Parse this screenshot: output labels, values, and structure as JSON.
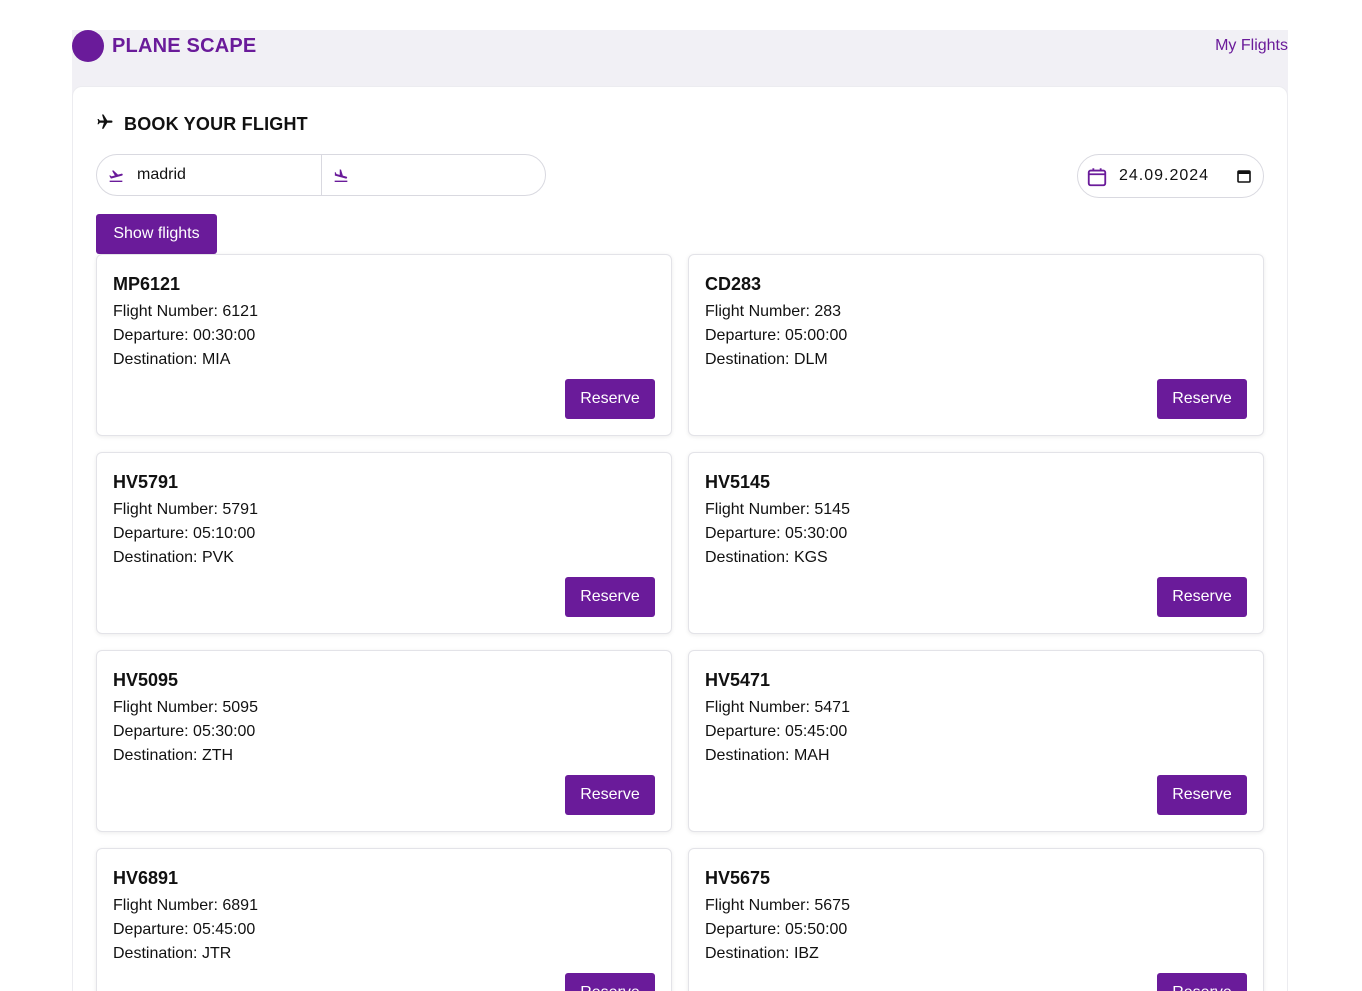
{
  "header": {
    "brand": "PLANE SCAPE",
    "nav_link": "My Flights"
  },
  "booking": {
    "title": "BOOK YOUR FLIGHT",
    "from_value": "madrid",
    "to_value": "",
    "date_value": "24.09.2024",
    "show_button": "Show flights"
  },
  "flights": [
    {
      "code": "MP6121",
      "number": "Flight Number: 6121",
      "departure": "Departure: 00:30:00",
      "destination": "Destination: MIA",
      "action": "Reserve"
    },
    {
      "code": "CD283",
      "number": "Flight Number: 283",
      "departure": "Departure: 05:00:00",
      "destination": "Destination: DLM",
      "action": "Reserve"
    },
    {
      "code": "HV5791",
      "number": "Flight Number: 5791",
      "departure": "Departure: 05:10:00",
      "destination": "Destination: PVK",
      "action": "Reserve"
    },
    {
      "code": "HV5145",
      "number": "Flight Number: 5145",
      "departure": "Departure: 05:30:00",
      "destination": "Destination: KGS",
      "action": "Reserve"
    },
    {
      "code": "HV5095",
      "number": "Flight Number: 5095",
      "departure": "Departure: 05:30:00",
      "destination": "Destination: ZTH",
      "action": "Reserve"
    },
    {
      "code": "HV5471",
      "number": "Flight Number: 5471",
      "departure": "Departure: 05:45:00",
      "destination": "Destination: MAH",
      "action": "Reserve"
    },
    {
      "code": "HV6891",
      "number": "Flight Number: 6891",
      "departure": "Departure: 05:45:00",
      "destination": "Destination: JTR",
      "action": "Reserve"
    },
    {
      "code": "HV5675",
      "number": "Flight Number: 5675",
      "departure": "Departure: 05:50:00",
      "destination": "Destination: IBZ",
      "action": "Reserve"
    }
  ],
  "colors": {
    "accent": "#6a1b9a",
    "header_bg": "#f1f0f5"
  }
}
